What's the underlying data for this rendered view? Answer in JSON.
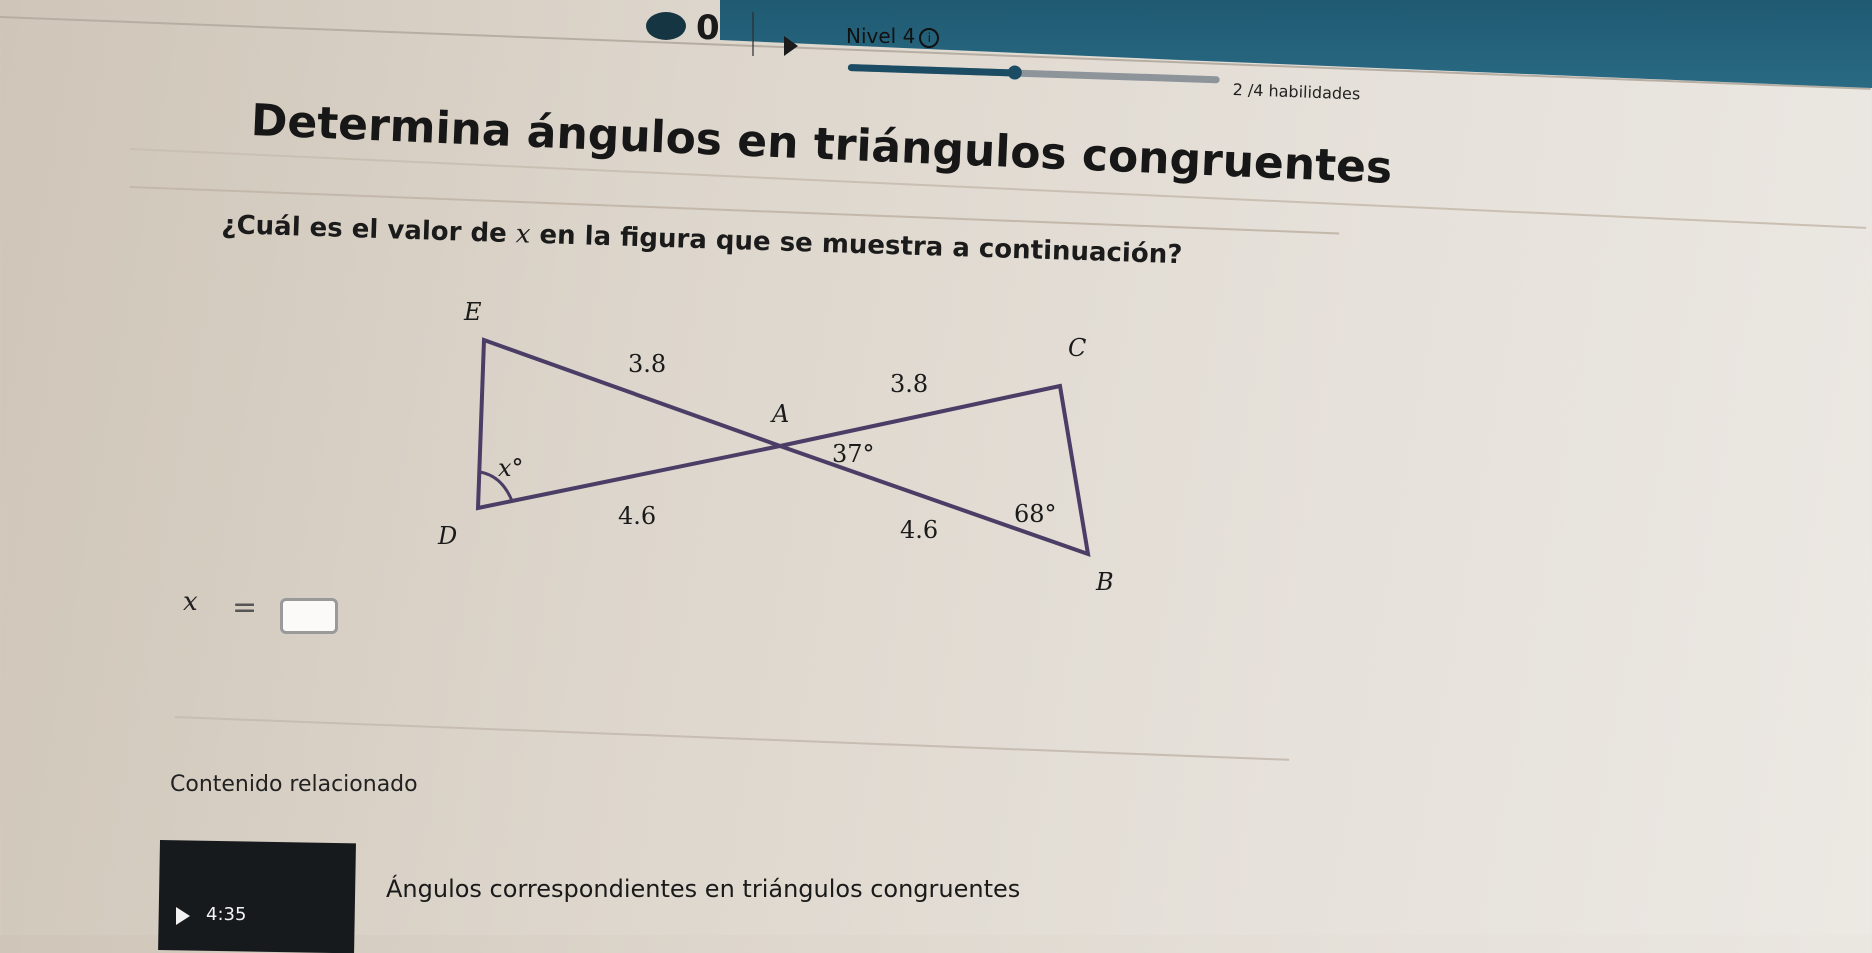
{
  "header": {
    "streak_count": "0",
    "level_label": "Nivel 4",
    "info_icon": "i",
    "progress": 0.45,
    "skills_text": "2 /4 habilidades"
  },
  "title": "Determina ángulos en triángulos congruentes",
  "question": {
    "prefix": "¿Cuál es el valor de ",
    "variable": "x",
    "suffix": " en la figura que se muestra a continuación?"
  },
  "figure": {
    "labels": {
      "E": "E",
      "C": "C",
      "A": "A",
      "D": "D",
      "B": "B"
    },
    "measures": {
      "ea": "3.8",
      "ac": "3.8",
      "da": "4.6",
      "ab": "4.6",
      "angle_a": "37°",
      "angle_b": "68°",
      "angle_d": "x°"
    }
  },
  "answer": {
    "variable": "x",
    "equals": "="
  },
  "related": {
    "heading": "Contenido relacionado",
    "video_title": "Ángulos correspondientes en triángulos congruentes",
    "video_duration": "4:35"
  },
  "colors": {
    "header_bg": "#1f5a72",
    "progress_fill": "#1c4c63"
  }
}
